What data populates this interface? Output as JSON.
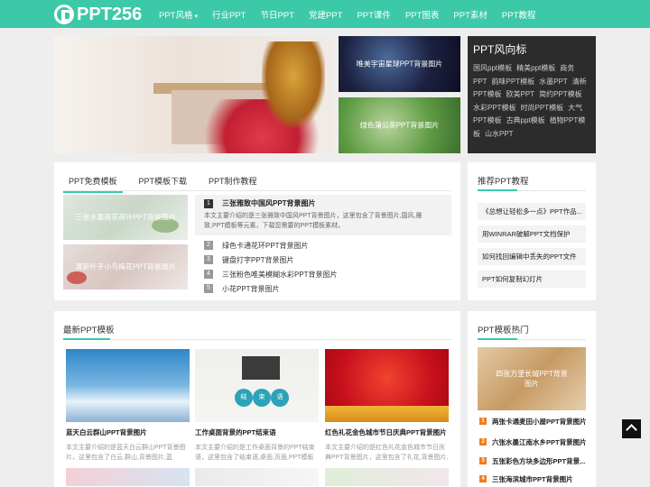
{
  "header": {
    "logo_text": "PPT256",
    "nav": [
      "PPT风格",
      "行业PPT",
      "节日PPT",
      "党建PPT",
      "PPT课件",
      "PPT图表",
      "PPT素材",
      "PPT教程"
    ]
  },
  "hero": {
    "tile1": "唯美宇宙星球PPT背景图片",
    "tile2": "绿色蒲公英PPT背景图片"
  },
  "tags": {
    "title": "PPT风向标",
    "items": [
      "国风ppt模板",
      "精美ppt模板",
      "商务PPT",
      "韵味PPT模板",
      "水墨PPT",
      "清新PPT模板",
      "欧美PPT",
      "简约PPT模板",
      "水彩PPT模板",
      "时尚PPT模板",
      "大气PPT模板",
      "古典ppt模板",
      "植物PPT模板",
      "山水PPT"
    ]
  },
  "tabs_panel": {
    "tabs": [
      "PPT免费模板",
      "PPT模板下载",
      "PPT制作教程"
    ],
    "thumbs": [
      "三张水墨荷花荷叶PPT背景图片",
      "清新叶子小鸟梅花PPT背景图片"
    ],
    "feature": {
      "num": "1",
      "title": "三张雅致中国风PPT背景图片",
      "desc": "本文主要介绍的是三张雅致中国风PPT背景图片，这里包含了背景图片,国风,雅致,PPT模板等元素，下载您需要的PPT模板素材。"
    },
    "list": [
      {
        "num": "2",
        "title": "绿色卡通花环PPT背景图片"
      },
      {
        "num": "3",
        "title": "键盘打字PPT背景图片"
      },
      {
        "num": "4",
        "title": "三张粉色唯美模糊水彩PPT背景图片"
      },
      {
        "num": "5",
        "title": "小花PPT背景图片"
      }
    ]
  },
  "recommend": {
    "title": "推荐PPT教程",
    "items": [
      "《总想让轻松多一点》PPT作品...",
      "用WINRAR破解PPT文档保护",
      "如何找回编辑中丢失的PPT文件",
      "PPT如何复制幻灯片"
    ]
  },
  "latest": {
    "title": "最新PPT模板",
    "cards": [
      {
        "title": "蓝天白云群山PPT背景图片",
        "desc": "本文主要介绍的是蓝天白云群山PPT背景图片，这里包含了白云,群山,背景图片,蓝"
      },
      {
        "title": "工作桌面背景的PPT结束语",
        "desc": "本文主要介绍的是工作桌面背景的PPT结束语，这里包含了结束语,桌面,页面,PPT模板",
        "badges": [
          "结",
          "束",
          "语"
        ]
      },
      {
        "title": "红色礼花金色城市节日庆典PPT背景图片",
        "desc": "本文主要介绍的是红色礼花金色城市节日庆典PPT背景图片，这里包含了礼花,背景图片,"
      }
    ]
  },
  "hot": {
    "title": "PPT模板热门",
    "image_caption": "四张万里长城PPT背景图片",
    "items": [
      {
        "num": "1",
        "title": "两张卡通麦田小屋PPT背景图片"
      },
      {
        "num": "2",
        "title": "六张水墨江南水乡PPT背景图片"
      },
      {
        "num": "3",
        "title": "五张彩色方块多边形PPT背景..."
      },
      {
        "num": "4",
        "title": "三张海滨城市PPT背景图片"
      }
    ]
  },
  "colors": {
    "brand": "#3cc9a7",
    "dark_box": "#2c2c2c",
    "order_num": "#f07d1e"
  }
}
